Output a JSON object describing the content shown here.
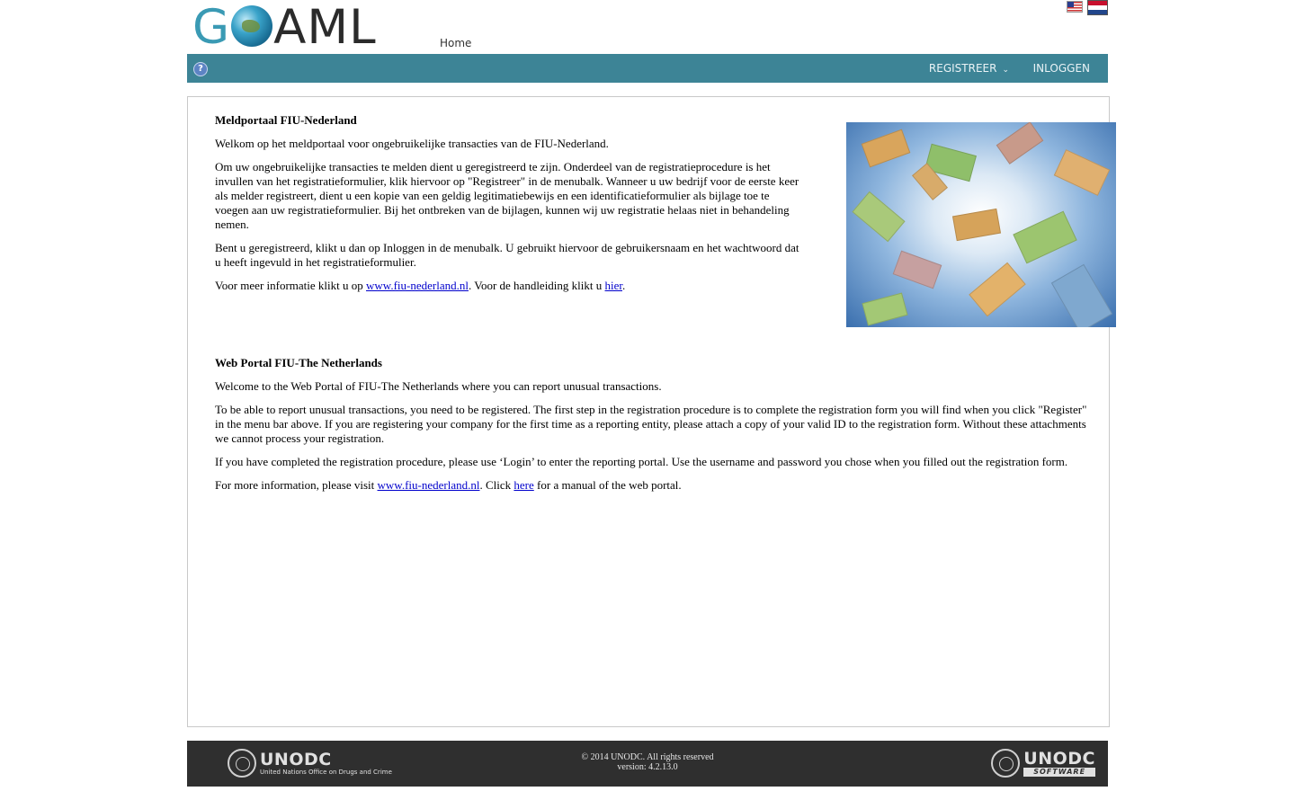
{
  "header": {
    "logo_text": "GOAML",
    "home_label": "Home",
    "flags": [
      "english-flag",
      "dutch-flag"
    ]
  },
  "nav": {
    "help_icon": "?",
    "registreer_label": "REGISTREER",
    "inloggen_label": "INLOGGEN"
  },
  "dutch": {
    "title": "Meldportaal FIU-Nederland",
    "welcome": "Welkom op het meldportaal voor ongebruikelijke transacties van de FIU-Nederland.",
    "registration": "Om uw ongebruikelijke transacties te melden dient u geregistreerd te zijn. Onderdeel van de registratieprocedure is het invullen van het registratieformulier, klik hiervoor op \"Registreer\" in de menubalk. Wanneer u uw bedrijf voor de eerste keer als melder registreert, dient u een kopie van een geldig legitimatiebewijs en een identificatieformulier als bijlage toe te voegen aan uw registratieformulier. Bij het ontbreken van de bijlagen, kunnen wij uw registratie helaas niet in behandeling nemen.",
    "login": "Bent u geregistreerd, klikt u dan op Inloggen in de menubalk. U gebruikt hiervoor de gebruikersnaam en het wachtwoord dat u heeft ingevuld in het registratieformulier.",
    "info_prefix": "Voor meer informatie klikt u op ",
    "info_link": "www.fiu-nederland.nl",
    "info_middle": ". Voor de handleiding klikt u ",
    "manual_link": "hier",
    "info_suffix": "."
  },
  "english": {
    "title": "Web Portal FIU-The Netherlands",
    "welcome": "Welcome to the Web Portal of FIU-The Netherlands where you can report unusual transactions.",
    "registration": "To be able to report unusual transactions, you need to be registered. The first step in the registration procedure is to complete the registration form you will find when you click \"Register\" in the menu bar above. If you are registering your company for the first time as a reporting entity, please attach a copy of your valid ID to the registration form. Without these attachments we cannot process your registration.",
    "login": "If you have completed the registration procedure, please use ‘Login’ to enter the reporting portal. Use the username and password you chose when you filled out the registration form.",
    "info_prefix": "For more information, please visit ",
    "info_link": "www.fiu-nederland.nl",
    "info_middle": ". Click ",
    "manual_link": "here",
    "info_suffix": " for a manual of the web portal."
  },
  "footer": {
    "left_logo": "UNODC",
    "left_subtitle": "United Nations Office on Drugs and Crime",
    "copyright": "© 2014 UNODC. All rights reserved",
    "version": "version: 4.2.13.0",
    "right_logo": "UNODC",
    "right_subtitle": "SOFTWARE"
  },
  "colors": {
    "navbar": "#3d8496",
    "footer": "#2f2f2f",
    "link": "#0000cc"
  }
}
